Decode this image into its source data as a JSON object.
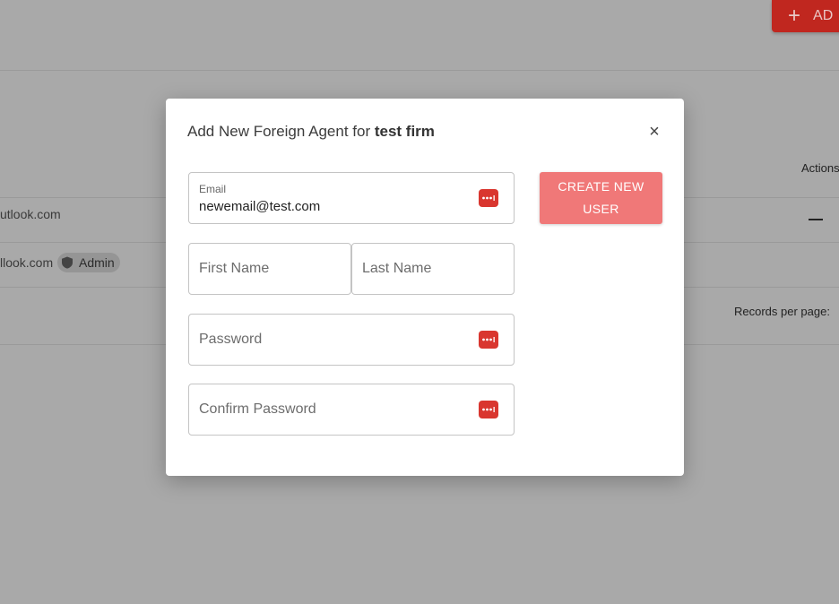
{
  "background": {
    "add_button_label": "AD",
    "actions_header": "Actions",
    "rows": [
      {
        "email": "utlook.com"
      },
      {
        "email": "llook.com",
        "badge": "Admin"
      }
    ],
    "records_per_page_label": "Records per page:"
  },
  "modal": {
    "title_prefix": "Add New Foreign Agent for ",
    "title_firm": "test firm",
    "close_glyph": "×",
    "email": {
      "label": "Email",
      "value": "newemail@test.com"
    },
    "first_name": {
      "placeholder": "First Name"
    },
    "last_name": {
      "placeholder": "Last Name"
    },
    "password": {
      "placeholder": "Password"
    },
    "confirm_password": {
      "placeholder": "Confirm Password"
    },
    "create_button_line1": "CREATE NEW",
    "create_button_line2": "USER",
    "colors": {
      "button": "#f07878",
      "password_manager_icon": "#d9362f",
      "accent": "#c0271f"
    }
  }
}
